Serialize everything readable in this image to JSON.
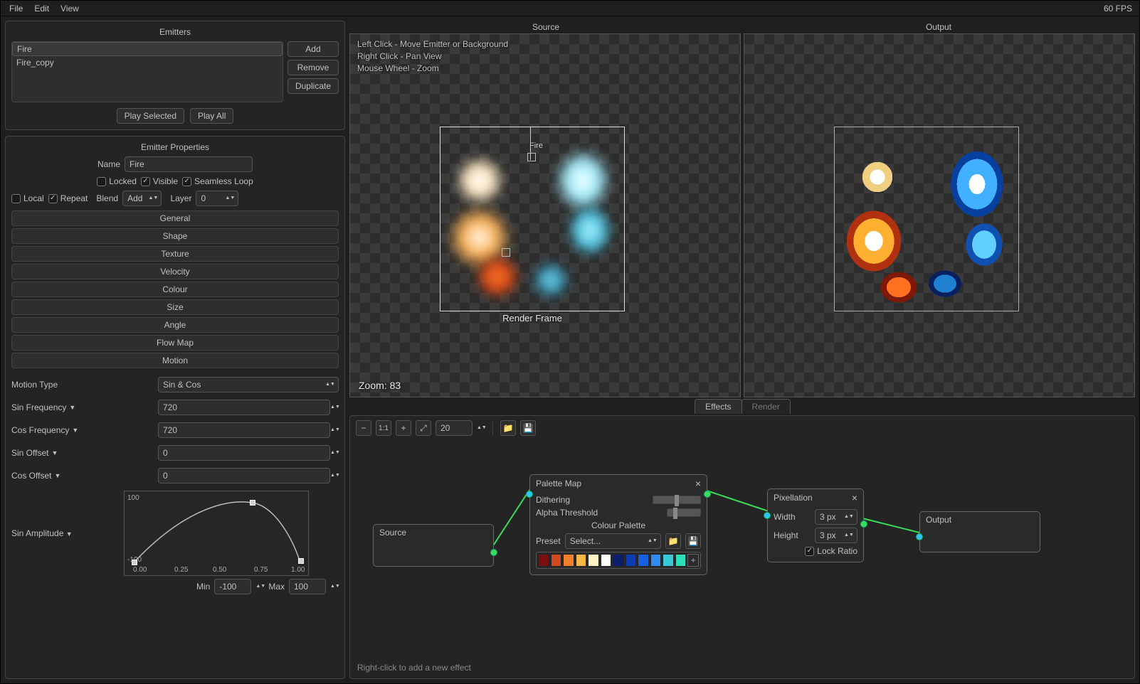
{
  "menubar": {
    "file": "File",
    "edit": "Edit",
    "view": "View",
    "fps": "60 FPS"
  },
  "emitters": {
    "title": "Emitters",
    "items": [
      "Fire",
      "Fire_copy"
    ],
    "add": "Add",
    "remove": "Remove",
    "duplicate": "Duplicate",
    "play_selected": "Play Selected",
    "play_all": "Play All"
  },
  "props": {
    "title": "Emitter Properties",
    "name_label": "Name",
    "name_value": "Fire",
    "locked": "Locked",
    "visible": "Visible",
    "seamless": "Seamless Loop",
    "local": "Local",
    "repeat": "Repeat",
    "blend_label": "Blend",
    "blend_value": "Add",
    "layer_label": "Layer",
    "layer_value": "0",
    "sections": [
      "General",
      "Shape",
      "Texture",
      "Velocity",
      "Colour",
      "Size",
      "Angle",
      "Flow Map",
      "Motion"
    ]
  },
  "motion": {
    "type_label": "Motion Type",
    "type_value": "Sin & Cos",
    "sin_freq_label": "Sin Frequency",
    "sin_freq_value": "720",
    "cos_freq_label": "Cos Frequency",
    "cos_freq_value": "720",
    "sin_off_label": "Sin Offset",
    "sin_off_value": "0",
    "cos_off_label": "Cos Offset",
    "cos_off_value": "0",
    "sin_amp_label": "Sin Amplitude",
    "graph": {
      "ymax": "100",
      "ymin": "-100",
      "ticks": [
        "0.00",
        "0.25",
        "0.50",
        "0.75",
        "1.00"
      ]
    },
    "min_label": "Min",
    "min_value": "-100",
    "max_label": "Max",
    "max_value": "100"
  },
  "viewports": {
    "source_title": "Source",
    "output_title": "Output",
    "help": [
      "Left Click - Move Emitter or Background",
      "Right Click - Pan View",
      "Mouse Wheel - Zoom"
    ],
    "zoom": "Zoom: 83",
    "render_frame": "Render Frame",
    "emitter_label": "Fire"
  },
  "tabs": {
    "effects": "Effects",
    "render": "Render"
  },
  "toolbar": {
    "value": "20"
  },
  "nodes": {
    "source": {
      "title": "Source"
    },
    "palette": {
      "title": "Palette Map",
      "dithering": "Dithering",
      "alpha": "Alpha Threshold",
      "colour_palette": "Colour Palette",
      "preset_label": "Preset",
      "preset_value": "Select...",
      "colors": [
        "#7a1010",
        "#d24b1e",
        "#f0812a",
        "#f6b946",
        "#fff3c6",
        "#ffffff",
        "#0b1f6a",
        "#0f3bb2",
        "#1860e0",
        "#2f8cf0",
        "#39c8d8",
        "#2be0b8"
      ]
    },
    "pixel": {
      "title": "Pixellation",
      "width_label": "Width",
      "width_value": "3 px",
      "height_label": "Height",
      "height_value": "3 px",
      "lock": "Lock Ratio"
    },
    "output": {
      "title": "Output"
    }
  },
  "hint": "Right-click to add a new effect"
}
